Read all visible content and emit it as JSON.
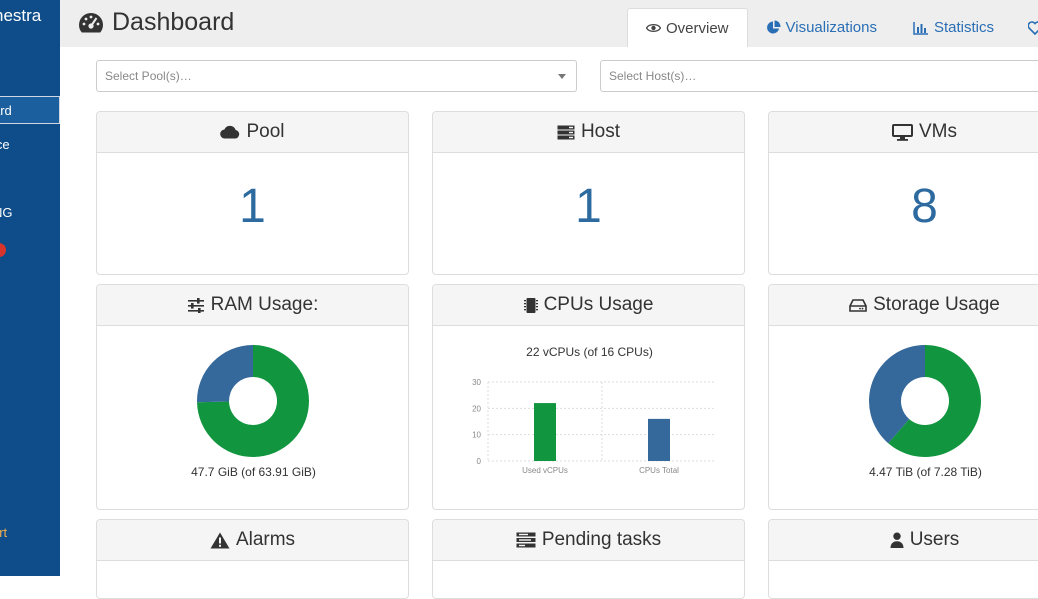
{
  "sidebar": {
    "brand": "nestra",
    "items": [
      {
        "label": "ard",
        "active": true
      },
      {
        "label": "ice",
        "active": false
      },
      {
        "label": "NG",
        "active": false
      }
    ],
    "support": "ort"
  },
  "header": {
    "title": "Dashboard",
    "title_icon": "dashboard-gauge-icon",
    "tabs": [
      {
        "label": "Overview",
        "icon": "eye-icon",
        "active": true
      },
      {
        "label": "Visualizations",
        "icon": "pie-chart-icon",
        "active": false
      },
      {
        "label": "Statistics",
        "icon": "bar-chart-icon",
        "active": false
      }
    ]
  },
  "filters": {
    "pools_placeholder": "Select Pool(s)…",
    "hosts_placeholder": "Select Host(s)…"
  },
  "cards": {
    "pool": {
      "title": "Pool",
      "icon": "cloud-icon",
      "value": "1"
    },
    "host": {
      "title": "Host",
      "icon": "server-icon",
      "value": "1"
    },
    "vms": {
      "title": "VMs",
      "icon": "desktop-icon",
      "value": "8"
    },
    "ram": {
      "title": "RAM Usage:",
      "icon": "sliders-icon",
      "caption": "47.7 GiB (of 63.91 GiB)",
      "used": 47.7,
      "total": 63.91
    },
    "cpu": {
      "title": "CPUs Usage",
      "icon": "chip-icon",
      "caption": "22 vCPUs (of 16 CPUs)"
    },
    "storage": {
      "title": "Storage Usage",
      "icon": "hdd-icon",
      "caption": "4.47 TiB (of 7.28 TiB)",
      "used": 4.47,
      "total": 7.28
    },
    "alarms": {
      "title": "Alarms",
      "icon": "warning-icon"
    },
    "pending": {
      "title": "Pending tasks",
      "icon": "tasks-icon"
    },
    "users": {
      "title": "Users",
      "icon": "user-icon"
    }
  },
  "colors": {
    "used": "#11963f",
    "free": "#35699c",
    "sidebar": "#0f4d8a",
    "accent": "#2d6a9f"
  },
  "chart_data": {
    "type": "bar",
    "categories": [
      "Used vCPUs",
      "CPUs Total"
    ],
    "values": [
      22,
      16
    ],
    "ylim": [
      0,
      30
    ],
    "yticks": [
      "0",
      "10",
      "20",
      "30"
    ],
    "grid": true
  }
}
